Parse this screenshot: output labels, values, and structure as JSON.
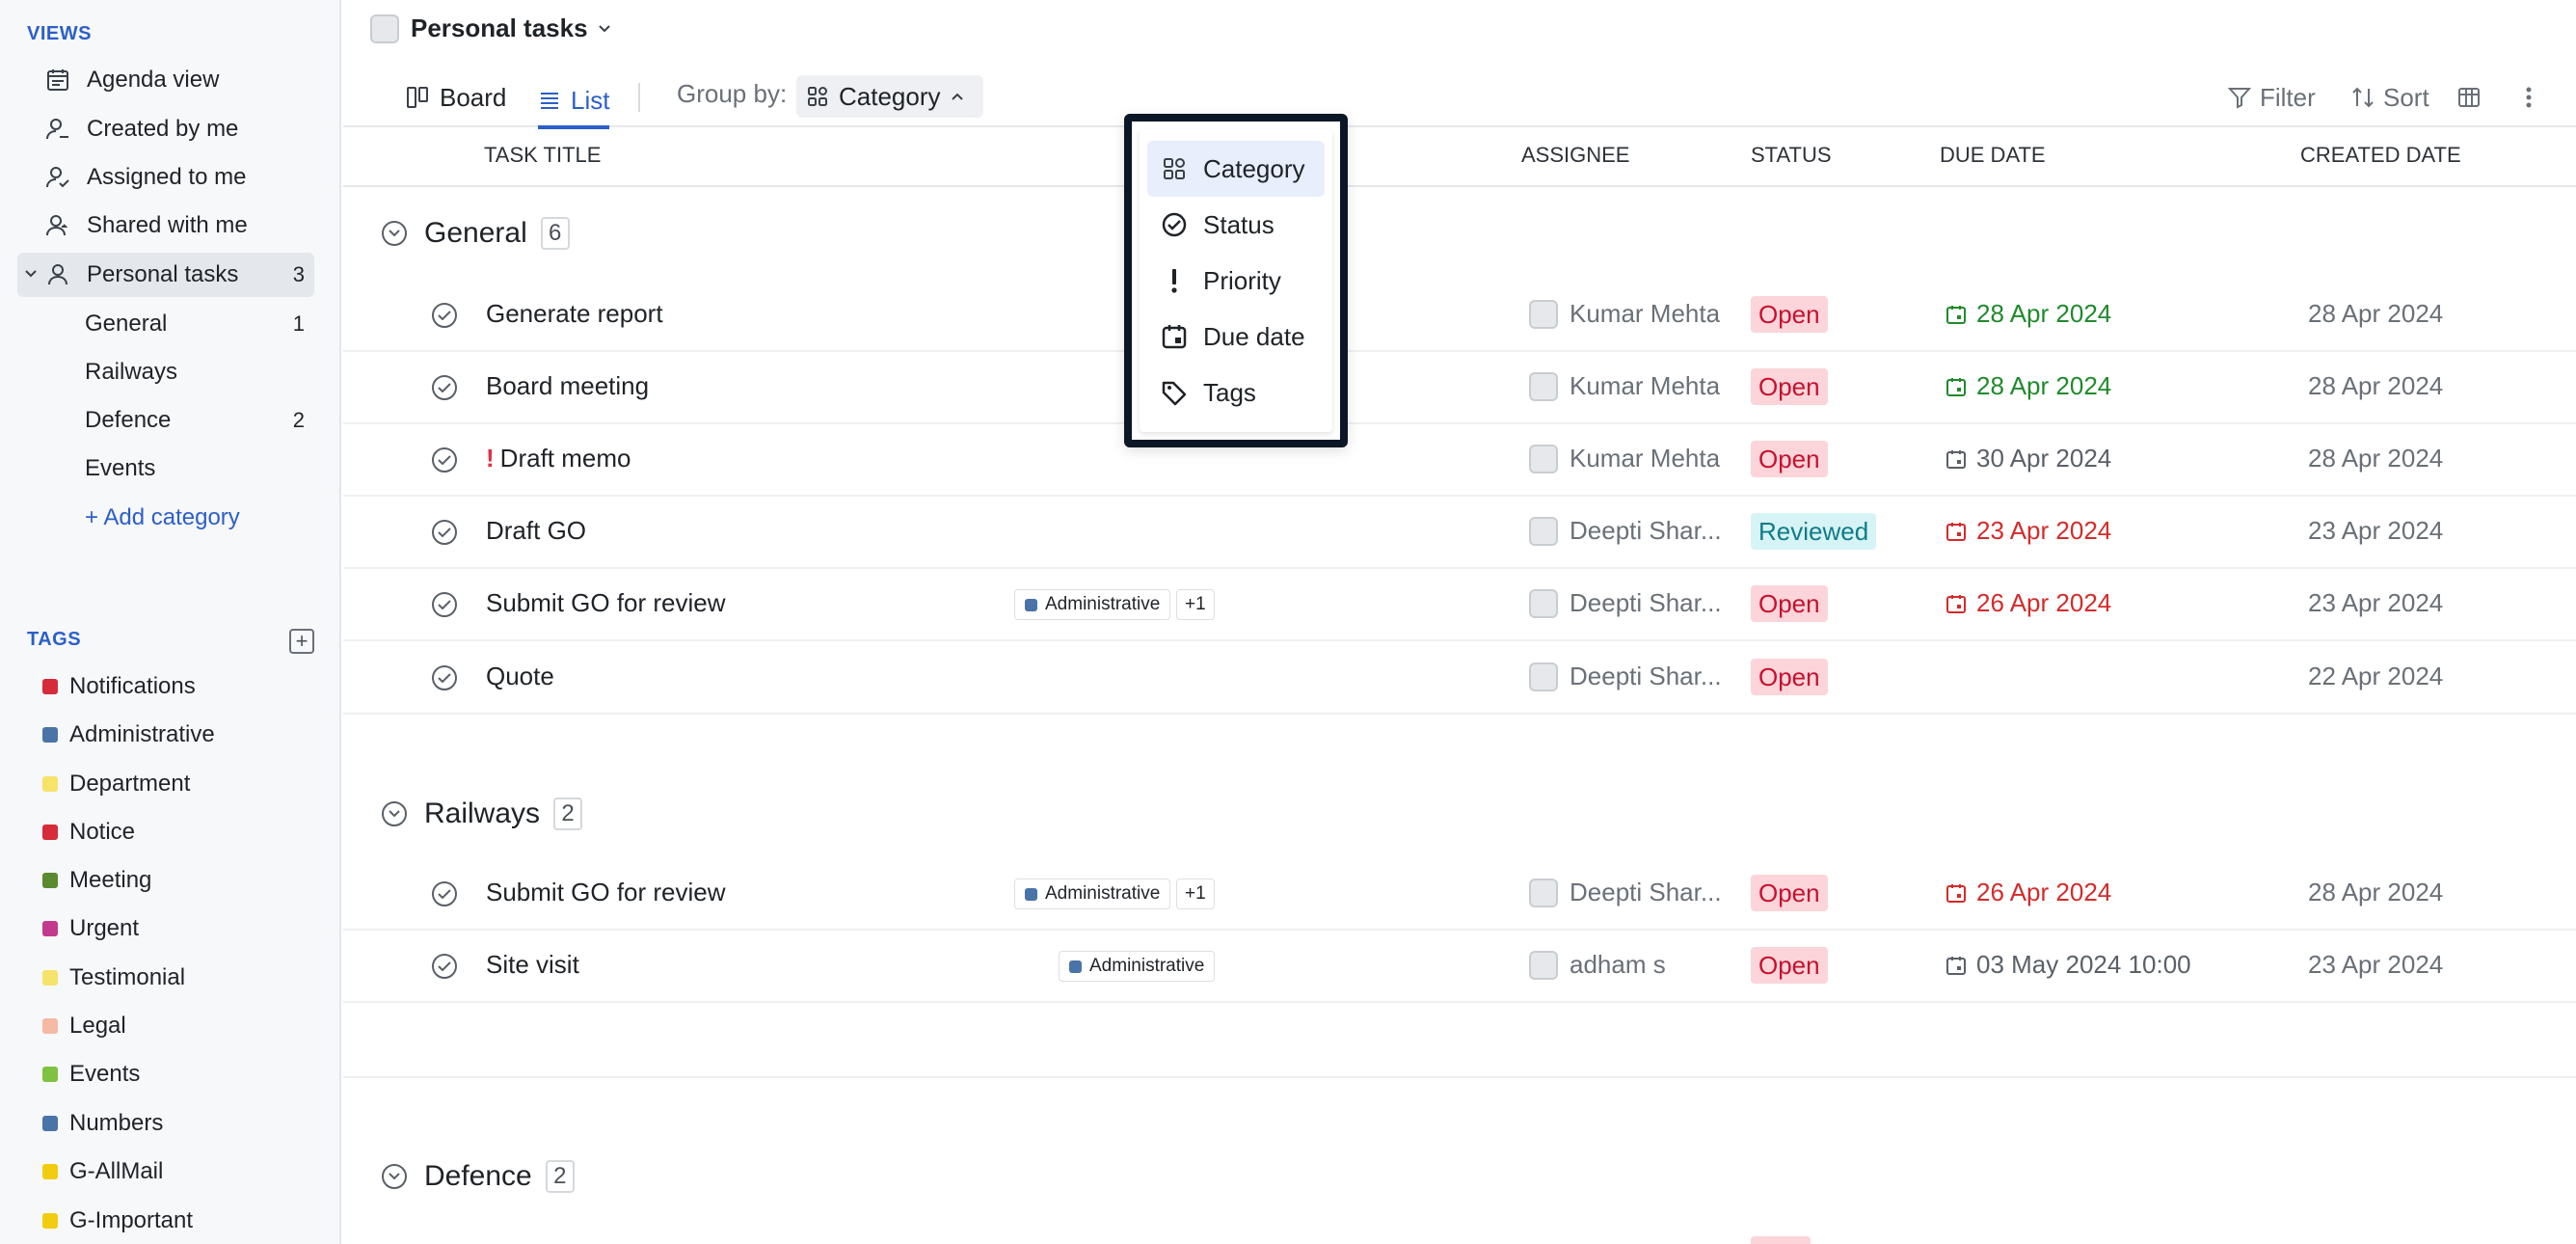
{
  "sidebar": {
    "views_label": "VIEWS",
    "views": [
      {
        "label": "Agenda view",
        "icon": "agenda-icon"
      },
      {
        "label": "Created by me",
        "icon": "user-created-icon"
      },
      {
        "label": "Assigned to me",
        "icon": "user-assigned-icon"
      },
      {
        "label": "Shared with me",
        "icon": "user-shared-icon"
      }
    ],
    "personal": {
      "label": "Personal tasks",
      "count": "3"
    },
    "categories": [
      {
        "label": "General",
        "count": "1"
      },
      {
        "label": "Railways",
        "count": ""
      },
      {
        "label": "Defence",
        "count": "2"
      },
      {
        "label": "Events",
        "count": ""
      }
    ],
    "add_category": "+ Add category",
    "tags_label": "TAGS",
    "tags": [
      {
        "label": "Notifications",
        "color": "#d62b3a"
      },
      {
        "label": "Administrative",
        "color": "#4a74a8"
      },
      {
        "label": "Department",
        "color": "#f5e36a"
      },
      {
        "label": "Notice",
        "color": "#d62b3a"
      },
      {
        "label": "Meeting",
        "color": "#5c8a2e"
      },
      {
        "label": "Urgent",
        "color": "#c23a8e"
      },
      {
        "label": "Testimonial",
        "color": "#f5e36a"
      },
      {
        "label": "Legal",
        "color": "#f6b9a4"
      },
      {
        "label": "Events",
        "color": "#7fc241"
      },
      {
        "label": "Numbers",
        "color": "#4a74a8"
      },
      {
        "label": "G-AllMail",
        "color": "#f2cd0f"
      },
      {
        "label": "G-Important",
        "color": "#f2cd0f"
      }
    ]
  },
  "header": {
    "title": "Personal tasks",
    "tabs": [
      {
        "label": "Board"
      },
      {
        "label": "List"
      }
    ],
    "group_by_label": "Group by:",
    "group_by_value": "Category",
    "filter": "Filter",
    "sort": "Sort"
  },
  "columns": {
    "title": "TASK TITLE",
    "assignee": "ASSIGNEE",
    "status": "STATUS",
    "due": "DUE DATE",
    "created": "CREATED DATE"
  },
  "groups": [
    {
      "name": "General",
      "count": "6",
      "rows": [
        {
          "title": "Generate report",
          "assignee": "Kumar Mehta",
          "status": "Open",
          "due": "28 Apr 2024",
          "created": "28 Apr 2024"
        },
        {
          "title": "Board meeting",
          "assignee": "Kumar Mehta",
          "status": "Open",
          "due": "28 Apr 2024",
          "created": "28 Apr 2024"
        },
        {
          "title": "Draft memo",
          "priority": "!",
          "assignee": "Kumar Mehta",
          "status": "Open",
          "due": "30 Apr 2024",
          "created": "28 Apr 2024"
        },
        {
          "title": "Draft GO",
          "assignee": "Deepti Shar...",
          "status": "Reviewed",
          "due": "23 Apr 2024",
          "created": "23 Apr 2024"
        },
        {
          "title": "Submit GO for review",
          "tag": "Administrative",
          "more": "+1",
          "assignee": "Deepti Shar...",
          "status": "Open",
          "due": "26 Apr 2024",
          "created": "23 Apr 2024"
        },
        {
          "title": "Quote",
          "assignee": "Deepti Shar...",
          "status": "Open",
          "due": "",
          "created": "22 Apr 2024"
        }
      ]
    },
    {
      "name": "Railways",
      "count": "2",
      "rows": [
        {
          "title": "Submit GO for review",
          "tag": "Administrative",
          "more": "+1",
          "assignee": "Deepti Shar...",
          "status": "Open",
          "due": "26 Apr 2024",
          "created": "28 Apr 2024"
        },
        {
          "title": "Site visit",
          "tag": "Administrative",
          "assignee": "adham s",
          "status": "Open",
          "due": "03 May 2024 10:00",
          "created": "23 Apr 2024"
        }
      ]
    },
    {
      "name": "Defence",
      "count": "2",
      "rows": []
    }
  ],
  "dropdown": {
    "items": [
      {
        "label": "Category",
        "icon": "category-icon"
      },
      {
        "label": "Status",
        "icon": "status-check-icon"
      },
      {
        "label": "Priority",
        "icon": "priority-icon"
      },
      {
        "label": "Due date",
        "icon": "calendar-icon"
      },
      {
        "label": "Tags",
        "icon": "tag-icon"
      }
    ]
  },
  "colors": {
    "accent": "#2b5fc9",
    "due_green": "#1f8a2c",
    "due_red": "#d42b2b",
    "due_gray": "#5a6068",
    "open_bg": "#fbd5da",
    "reviewed_bg": "#d6f3f5"
  }
}
